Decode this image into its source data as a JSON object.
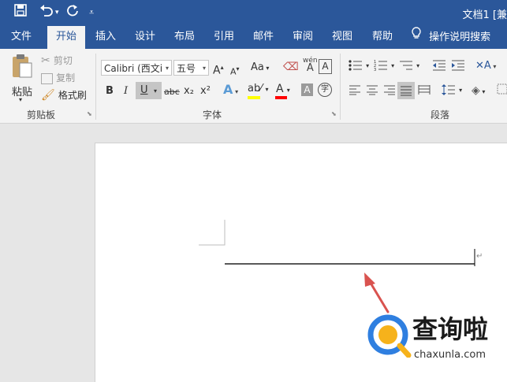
{
  "quick_access": {
    "save_icon": "save-icon",
    "undo_icon": "undo-icon",
    "redo_icon": "redo-icon",
    "customize_icon": "customize-icon"
  },
  "window": {
    "title": "文档1 [兼"
  },
  "tabs": [
    {
      "label": "文件"
    },
    {
      "label": "开始"
    },
    {
      "label": "插入"
    },
    {
      "label": "设计"
    },
    {
      "label": "布局"
    },
    {
      "label": "引用"
    },
    {
      "label": "邮件"
    },
    {
      "label": "审阅"
    },
    {
      "label": "视图"
    },
    {
      "label": "帮助"
    }
  ],
  "tell_me": {
    "label": "操作说明搜索"
  },
  "clipboard": {
    "paste_label": "粘贴",
    "cut_label": "剪切",
    "copy_label": "复制",
    "format_painter_label": "格式刷",
    "group_label": "剪贴板"
  },
  "font": {
    "font_name": "Calibri (西文i",
    "font_size": "五号",
    "group_label": "字体",
    "bold": "B",
    "italic": "I",
    "underline": "U",
    "strike": "abc",
    "sub": "x₂",
    "sup": "x²",
    "grow": "A",
    "shrink": "A",
    "case": "Aa",
    "phonetic_top": "wén",
    "phonetic_bottom": "A",
    "border_char": "A",
    "enclose_char": "字",
    "effects": "A",
    "highlight_color": "#ffff00",
    "font_color": "#ff0000"
  },
  "paragraph": {
    "group_label": "段落"
  },
  "document": {
    "paragraph_mark": "↵"
  },
  "watermark": {
    "brand": "查询啦",
    "url": "chaxunla.com"
  },
  "colors": {
    "ribbon_blue": "#2b579a",
    "arrow_red": "#d9534f"
  }
}
